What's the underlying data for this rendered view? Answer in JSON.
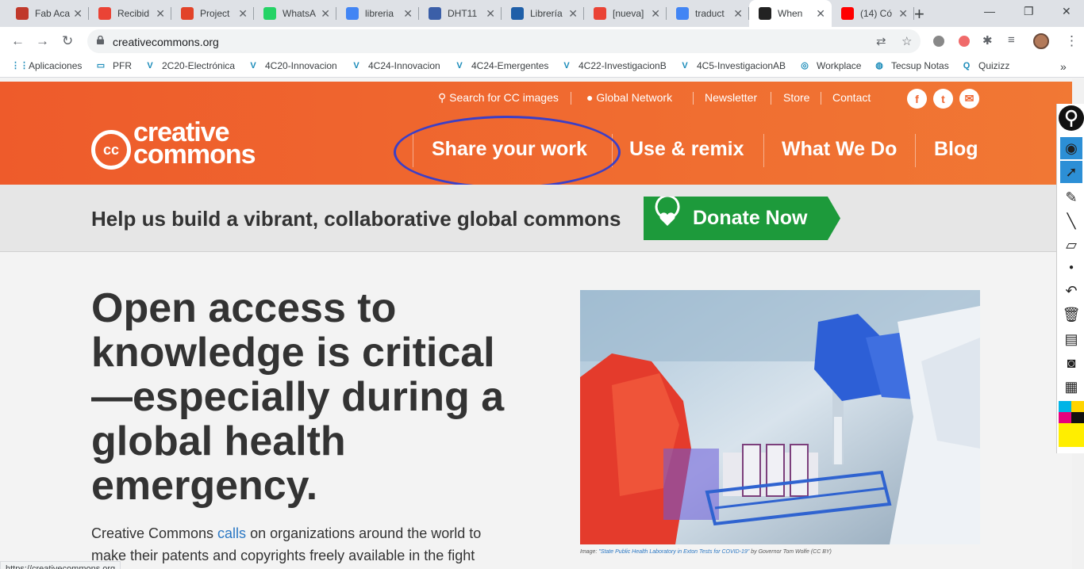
{
  "browser": {
    "tabs": [
      {
        "title": "Fab Aca",
        "icon": "fab-academy-icon",
        "color": "#c0392b"
      },
      {
        "title": "Recibid",
        "icon": "gmail-icon",
        "color": "#ea4335"
      },
      {
        "title": "Project",
        "icon": "gitlab-icon",
        "color": "#e24329"
      },
      {
        "title": "WhatsA",
        "icon": "whatsapp-icon",
        "color": "#25d366"
      },
      {
        "title": "libreria",
        "icon": "google-icon",
        "color": "#4285f4"
      },
      {
        "title": "DHT11",
        "icon": "wordpress-icon",
        "color": "#3b5fa8"
      },
      {
        "title": "Librería",
        "icon": "ph-icon",
        "color": "#1f5fa8"
      },
      {
        "title": "[nueva]",
        "icon": "gmail-icon",
        "color": "#ea4335"
      },
      {
        "title": "traduct",
        "icon": "google-icon",
        "color": "#4285f4"
      },
      {
        "title": "When",
        "icon": "cc-icon",
        "color": "#222222",
        "active": true
      },
      {
        "title": "(14) Có",
        "icon": "youtube-icon",
        "color": "#ff0000"
      }
    ],
    "url": "creativecommons.org",
    "bookmarks": [
      {
        "label": "Aplicaciones",
        "icon": "apps-grid-icon"
      },
      {
        "label": "PFR",
        "icon": "pfr-icon"
      },
      {
        "label": "2C20-Electrónica",
        "icon": "v-icon"
      },
      {
        "label": "4C20-Innovacion",
        "icon": "v-icon"
      },
      {
        "label": "4C24-Innovacion",
        "icon": "v-icon"
      },
      {
        "label": "4C24-Emergentes",
        "icon": "v-icon"
      },
      {
        "label": "4C22-InvestigacionB",
        "icon": "v-icon"
      },
      {
        "label": "4C5-InvestigacionAB",
        "icon": "v-icon"
      },
      {
        "label": "Workplace",
        "icon": "workplace-icon"
      },
      {
        "label": "Tecsup Notas",
        "icon": "globe-icon"
      },
      {
        "label": "Quizizz",
        "icon": "quizizz-icon"
      }
    ],
    "status_url": "https://creativecommons.org"
  },
  "site": {
    "utility_nav": {
      "search": "Search for CC images",
      "global": "Global Network",
      "newsletter": "Newsletter",
      "store": "Store",
      "contact": "Contact"
    },
    "logo_top": "creative",
    "logo_bottom": "commons",
    "logo_badge": "cc",
    "main_nav": [
      "Share your work",
      "Use & remix",
      "What We Do",
      "Blog"
    ],
    "donate_text": "Help us build a vibrant, collaborative global commons",
    "donate_button": "Donate Now",
    "headline": "Open access to knowledge is critical—especially during a global health emergency.",
    "body_pre": "Creative Commons ",
    "body_link": "calls",
    "body_post": " on organizations around the world to make their patents and copyrights freely available in the fight",
    "caption_pre": "Image: ",
    "caption_link": "\"State Public Health Laboratory in Exton Tests for COVID-19\"",
    "caption_post": " by Governor Tom Wolfe (CC BY)"
  },
  "colors": {
    "header_orange": "#ef6531",
    "donate_green": "#1d9a3b",
    "annotation_circle": "#3b3fc7",
    "link_blue": "#2b78c4"
  }
}
